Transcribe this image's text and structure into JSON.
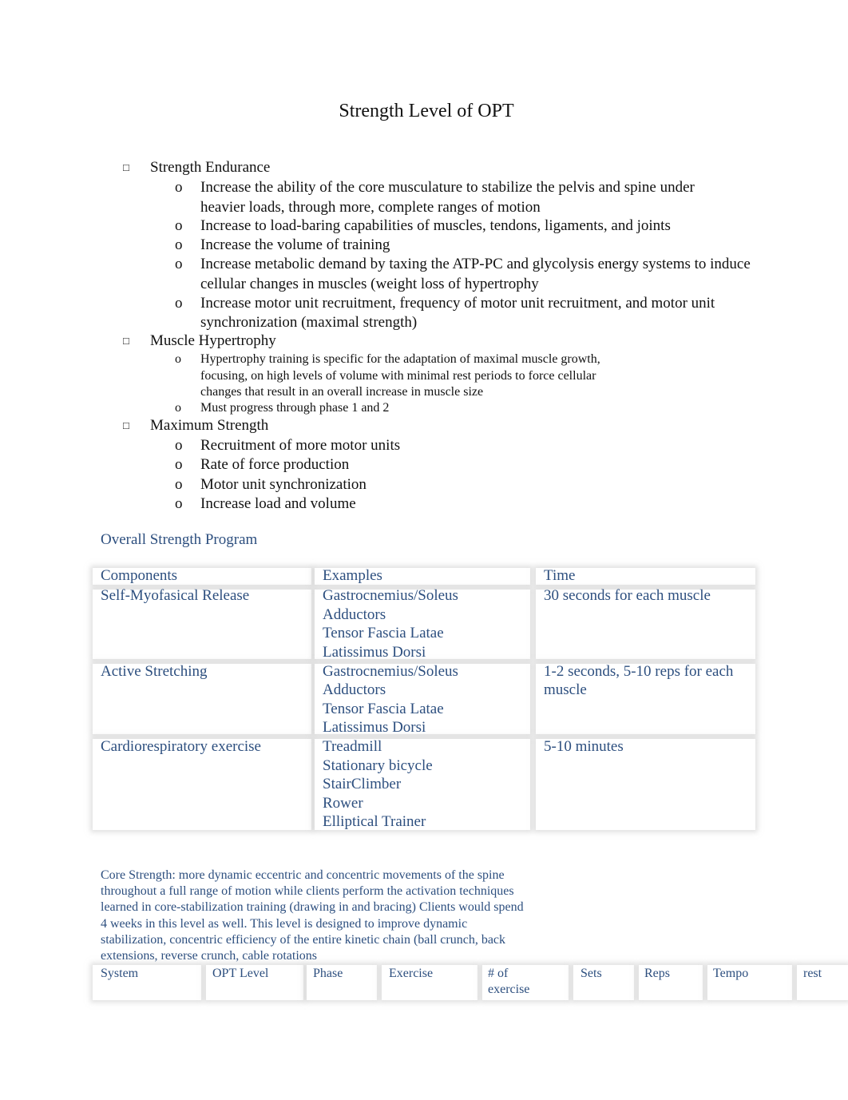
{
  "title": "Strength Level of OPT",
  "bullet_glyph": "",
  "sub_bullet_glyph": "o",
  "outline": [
    {
      "label": "Strength Endurance",
      "items": [
        [
          "Increase the ability of the core musculature to stabilize the pelvis and spine under",
          "heavier loads, through more, complete ranges of motion"
        ],
        [
          "Increase to load-baring capabilities of muscles, tendons, ligaments, and joints"
        ],
        [
          "Increase the volume of training"
        ],
        [
          "Increase metabolic demand by taxing the ATP-PC and glycolysis energy systems to induce",
          "cellular changes in muscles (weight loss of hypertrophy"
        ],
        [
          "Increase motor unit recruitment, frequency of motor unit recruitment, and motor unit",
          "synchronization (maximal strength)"
        ]
      ]
    },
    {
      "label": "Muscle Hypertrophy",
      "small": true,
      "items": [
        [
          "Hypertrophy training is specific for the adaptation of maximal muscle growth,",
          "focusing, on high levels of volume with minimal rest periods to force cellular",
          "changes that result in an overall increase in muscle size"
        ],
        [
          "Must progress through phase 1 and 2"
        ]
      ]
    },
    {
      "label": "Maximum Strength",
      "items": [
        [
          "Recruitment of more motor units"
        ],
        [
          "Rate of force production"
        ],
        [
          "Motor unit synchronization"
        ],
        [
          "Increase load and volume"
        ]
      ]
    }
  ],
  "program": {
    "heading": "Overall Strength Program",
    "headers": [
      "Components",
      "Examples",
      "Time"
    ],
    "rows": [
      {
        "component": "Self-Myofasical Release",
        "examples": [
          "Gastrocnemius/Soleus",
          "Adductors",
          "Tensor Fascia Latae",
          "Latissimus Dorsi"
        ],
        "time": [
          "30 seconds for each muscle"
        ]
      },
      {
        "component": "Active Stretching",
        "examples": [
          "Gastrocnemius/Soleus",
          "Adductors",
          "Tensor Fascia Latae",
          "Latissimus Dorsi"
        ],
        "time": [
          "1-2 seconds, 5-10 reps for each",
          "muscle"
        ]
      },
      {
        "component": "Cardiorespiratory exercise",
        "examples": [
          "Treadmill",
          "Stationary bicycle",
          "StairClimber",
          "Rower",
          "Elliptical Trainer"
        ],
        "time": [
          "5-10 minutes"
        ]
      }
    ]
  },
  "core": {
    "paragraph": [
      "Core Strength: more dynamic eccentric and concentric movements of the spine",
      "throughout a full range of motion while clients perform the activation techniques",
      "learned in core-stabilization training (drawing in and bracing) Clients would spend",
      "4 weeks in this level as well. This level is designed to improve dynamic",
      "stabilization, concentric efficiency of the entire kinetic chain (ball crunch, back",
      "extensions, reverse crunch, cable rotations"
    ],
    "headers": [
      [
        "System"
      ],
      [
        "OPT Level"
      ],
      [
        "Phase"
      ],
      [
        "Exercise"
      ],
      [
        "# of",
        "exercise"
      ],
      [
        "Sets"
      ],
      [
        "Reps"
      ],
      [
        "Tempo"
      ],
      [
        "rest"
      ]
    ]
  },
  "colors": {
    "accent_text": "#2d4f7f",
    "body_text": "#111111"
  }
}
